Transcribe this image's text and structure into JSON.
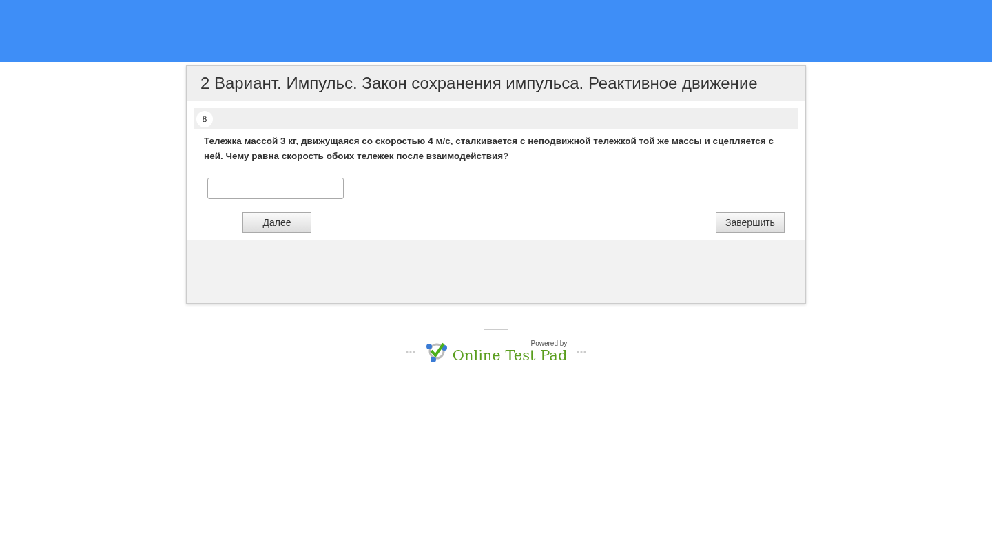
{
  "test": {
    "title": "2 Вариант. Импульс. Закон сохранения импульса. Реактивное движение"
  },
  "question": {
    "number": "8",
    "text": "Тележка массой 3 кг, движущаяся со скоростью 4 м/с, сталкивается с неподвижной тележкой той же массы и сцепляется с ней. Чему равна скорость обоих тележек после взаимодействия?"
  },
  "buttons": [
    {
      "kind": "next",
      "label": "Далее"
    },
    {
      "kind": "finish",
      "label": "Завершить"
    }
  ],
  "footer": {
    "powered_by": "Powered by",
    "brand": "Online Test Pad"
  }
}
